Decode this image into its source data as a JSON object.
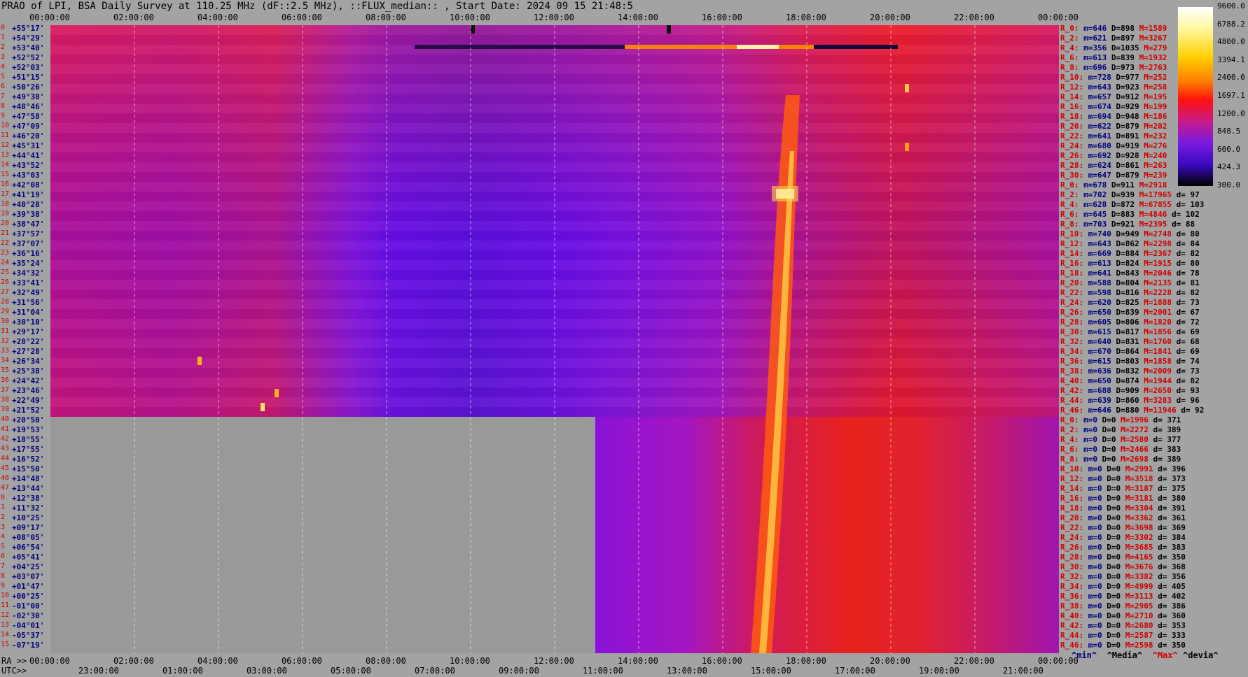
{
  "title": "PRAO of LPI, BSA Daily Survey at 110.25 MHz (dF::2.5 MHz), ::FLUX_median:: , Start Date: 2024 09 15 21:48:5",
  "axes": {
    "ra_prefix": "RA >>",
    "utc_prefix": "UTC>>",
    "top_ticks": [
      "00:00:00",
      "02:00:00",
      "04:00:00",
      "06:00:00",
      "08:00:00",
      "10:00:00",
      "12:00:00",
      "14:00:00",
      "16:00:00",
      "18:00:00",
      "20:00:00",
      "22:00:00",
      "00:00:00"
    ],
    "utc_ticks": [
      "23:00:00",
      "01:00:00",
      "03:00:00",
      "05:00:00",
      "07:00:00",
      "09:00:00",
      "11:00:00",
      "13:00:00",
      "15:00:00",
      "17:00:00",
      "19:00:00",
      "21:00:00"
    ]
  },
  "declinations": [
    "+55°17'",
    "+54°29'",
    "+53°40'",
    "+52°52'",
    "+52°03'",
    "+51°15'",
    "+50°26'",
    "+49°38'",
    "+48°46'",
    "+47°58'",
    "+47°09'",
    "+46°20'",
    "+45°31'",
    "+44°41'",
    "+43°52'",
    "+43°03'",
    "+42°08'",
    "+41°19'",
    "+40°28'",
    "+39°38'",
    "+38°47'",
    "+37°57'",
    "+37°07'",
    "+36°16'",
    "+35°24'",
    "+34°32'",
    "+33°41'",
    "+32°49'",
    "+31°56'",
    "+31°04'",
    "+30°10'",
    "+29°17'",
    "+28°22'",
    "+27°28'",
    "+26°34'",
    "+25°38'",
    "+24°42'",
    "+23°46'",
    "+22°49'",
    "+21°52'",
    "+20°50'",
    "+19°53'",
    "+18°55'",
    "+17°55'",
    "+16°52'",
    "+15°50'",
    "+14°48'",
    "+13°44'",
    "+12°38'",
    "+11°32'",
    "+10°25'",
    "+09°17'",
    "+08°05'",
    "+06°54'",
    "+05°41'",
    "+04°25'",
    "+03°07'",
    "+01°47'",
    "+00°25'",
    "-01°00'",
    "-02°30'",
    "-04°01'",
    "-05°37'",
    "-07°19'"
  ],
  "stats": [
    [
      "R_0:",
      "m=646",
      "D=898",
      "M=1589",
      ""
    ],
    [
      "R_2:",
      "m=621",
      "D=897",
      "M=3267",
      ""
    ],
    [
      "R_4:",
      "m=356",
      "D=1035",
      "M=279",
      ""
    ],
    [
      "R_6:",
      "m=613",
      "D=839",
      "M=1932",
      ""
    ],
    [
      "R_8:",
      "m=696",
      "D=973",
      "M=2763",
      ""
    ],
    [
      "R_10:",
      "m=728",
      "D=977",
      "M=252",
      ""
    ],
    [
      "R_12:",
      "m=643",
      "D=923",
      "M=258",
      ""
    ],
    [
      "R_14:",
      "m=657",
      "D=912",
      "M=195",
      ""
    ],
    [
      "R_16:",
      "m=674",
      "D=929",
      "M=199",
      ""
    ],
    [
      "R_18:",
      "m=694",
      "D=948",
      "M=186",
      ""
    ],
    [
      "R_20:",
      "m=622",
      "D=879",
      "M=202",
      ""
    ],
    [
      "R_22:",
      "m=641",
      "D=891",
      "M=232",
      ""
    ],
    [
      "R_24:",
      "m=680",
      "D=919",
      "M=276",
      ""
    ],
    [
      "R_26:",
      "m=692",
      "D=928",
      "M=240",
      ""
    ],
    [
      "R_28:",
      "m=624",
      "D=861",
      "M=263",
      ""
    ],
    [
      "R_30:",
      "m=647",
      "D=879",
      "M=239",
      ""
    ],
    [
      "R_0:",
      "m=678",
      "D=911",
      "M=2918",
      ""
    ],
    [
      "R_2:",
      "m=702",
      "D=939",
      "M=17965",
      "d= 97"
    ],
    [
      "R_4:",
      "m=628",
      "D=872",
      "M=67855",
      "d= 103"
    ],
    [
      "R_6:",
      "m=645",
      "D=883",
      "M=4846",
      "d= 102"
    ],
    [
      "R_8:",
      "m=703",
      "D=921",
      "M=2395",
      "d= 88"
    ],
    [
      "R_10:",
      "m=740",
      "D=949",
      "M=2748",
      "d= 80"
    ],
    [
      "R_12:",
      "m=643",
      "D=862",
      "M=2298",
      "d= 84"
    ],
    [
      "R_14:",
      "m=669",
      "D=884",
      "M=2367",
      "d= 82"
    ],
    [
      "R_16:",
      "m=613",
      "D=824",
      "M=1915",
      "d= 80"
    ],
    [
      "R_18:",
      "m=641",
      "D=843",
      "M=2046",
      "d= 78"
    ],
    [
      "R_20:",
      "m=588",
      "D=804",
      "M=2135",
      "d= 81"
    ],
    [
      "R_22:",
      "m=598",
      "D=816",
      "M=2228",
      "d= 82"
    ],
    [
      "R_24:",
      "m=620",
      "D=825",
      "M=1888",
      "d= 73"
    ],
    [
      "R_26:",
      "m=650",
      "D=839",
      "M=2001",
      "d= 67"
    ],
    [
      "R_28:",
      "m=605",
      "D=806",
      "M=1820",
      "d= 72"
    ],
    [
      "R_30:",
      "m=615",
      "D=817",
      "M=1856",
      "d= 69"
    ],
    [
      "R_32:",
      "m=640",
      "D=831",
      "M=1760",
      "d= 68"
    ],
    [
      "R_34:",
      "m=670",
      "D=864",
      "M=1841",
      "d= 69"
    ],
    [
      "R_36:",
      "m=615",
      "D=803",
      "M=1858",
      "d= 74"
    ],
    [
      "R_38:",
      "m=636",
      "D=832",
      "M=2009",
      "d= 73"
    ],
    [
      "R_40:",
      "m=650",
      "D=874",
      "M=1944",
      "d= 82"
    ],
    [
      "R_42:",
      "m=688",
      "D=909",
      "M=2650",
      "d= 93"
    ],
    [
      "R_44:",
      "m=639",
      "D=860",
      "M=3283",
      "d= 96"
    ],
    [
      "R_46:",
      "m=646",
      "D=880",
      "M=11946",
      "d= 92"
    ],
    [
      "R_0:",
      "m=0",
      "D=0",
      "M=1996",
      "d= 371"
    ],
    [
      "R_2:",
      "m=0",
      "D=0",
      "M=2272",
      "d= 389"
    ],
    [
      "R_4:",
      "m=0",
      "D=0",
      "M=2580",
      "d= 377"
    ],
    [
      "R_6:",
      "m=0",
      "D=0",
      "M=2466",
      "d= 383"
    ],
    [
      "R_8:",
      "m=0",
      "D=0",
      "M=2698",
      "d= 389"
    ],
    [
      "R_10:",
      "m=0",
      "D=0",
      "M=2991",
      "d= 396"
    ],
    [
      "R_12:",
      "m=0",
      "D=0",
      "M=3518",
      "d= 373"
    ],
    [
      "R_14:",
      "m=0",
      "D=0",
      "M=3187",
      "d= 375"
    ],
    [
      "R_16:",
      "m=0",
      "D=0",
      "M=3181",
      "d= 380"
    ],
    [
      "R_18:",
      "m=0",
      "D=0",
      "M=3304",
      "d= 391"
    ],
    [
      "R_20:",
      "m=0",
      "D=0",
      "M=3362",
      "d= 361"
    ],
    [
      "R_22:",
      "m=0",
      "D=0",
      "M=3698",
      "d= 369"
    ],
    [
      "R_24:",
      "m=0",
      "D=0",
      "M=3302",
      "d= 384"
    ],
    [
      "R_26:",
      "m=0",
      "D=0",
      "M=3685",
      "d= 383"
    ],
    [
      "R_28:",
      "m=0",
      "D=0",
      "M=4165",
      "d= 350"
    ],
    [
      "R_30:",
      "m=0",
      "D=0",
      "M=3676",
      "d= 368"
    ],
    [
      "R_32:",
      "m=0",
      "D=0",
      "M=3382",
      "d= 356"
    ],
    [
      "R_34:",
      "m=0",
      "D=0",
      "M=4999",
      "d= 405"
    ],
    [
      "R_36:",
      "m=0",
      "D=0",
      "M=3113",
      "d= 402"
    ],
    [
      "R_38:",
      "m=0",
      "D=0",
      "M=2905",
      "d= 386"
    ],
    [
      "R_40:",
      "m=0",
      "D=0",
      "M=2710",
      "d= 360"
    ],
    [
      "R_42:",
      "m=0",
      "D=0",
      "M=2680",
      "d= 353"
    ],
    [
      "R_44:",
      "m=0",
      "D=0",
      "M=2587",
      "d= 333"
    ],
    [
      "R_46:",
      "m=0",
      "D=0",
      "M=2598",
      "d= 350"
    ]
  ],
  "colorbar": {
    "ticks": [
      "9600.0",
      "6788.2",
      "4800.0",
      "3394.1",
      "2400.0",
      "1697.1",
      "1200.0",
      "848.5",
      "600.0",
      "424.3",
      "300.0"
    ]
  },
  "legend": {
    "min": "^min^",
    "median": "^Media^",
    "max": "^Max^",
    "dev": "^devia^"
  },
  "chart_data": {
    "type": "heatmap",
    "title": "PRAO of LPI, BSA Daily Survey at 110.25 MHz (dF::2.5 MHz), ::FLUX_median:: , Start Date: 2024 09 15 21:48:5",
    "x_axis": "RA / UTC",
    "y_axis": "Declination",
    "color_scale": "log, 300.0 - 9600.0",
    "note_empty_region": "lower-left block (rows 40-63, RA 00h-13h) has no data"
  },
  "colors": {
    "dec_num": "#d00000",
    "dec_label": "#000080",
    "background": "#a3a3a3"
  }
}
